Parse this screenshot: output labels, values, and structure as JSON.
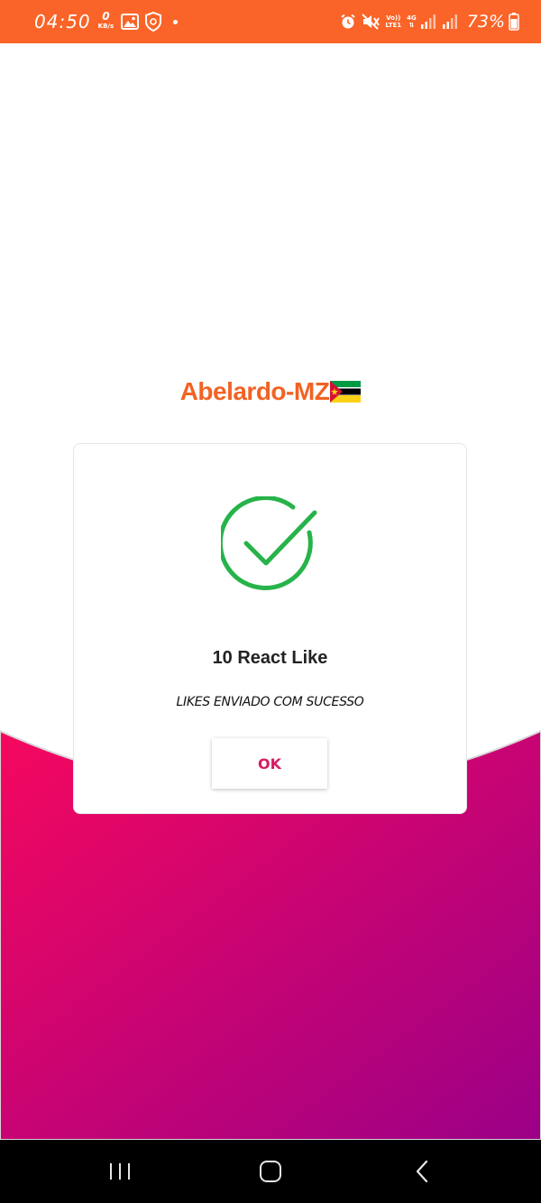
{
  "status_bar": {
    "time": "04:50",
    "speed_value": "0",
    "speed_unit": "KB/s",
    "volte_top": "Vo))",
    "volte_bottom": "LTE1",
    "network_type": "4G",
    "battery_percent": "73%",
    "background_color": "#fa6428"
  },
  "brand": {
    "name": "Abelardo-MZ",
    "color": "#f26224",
    "flag_icon": "mozambique-flag-icon"
  },
  "dialog": {
    "icon": "success-check-icon",
    "icon_color": "#27b34a",
    "title": "10 React Like",
    "message": "LIKES ENVIADO COM SUCESSO",
    "ok_label": "OK",
    "ok_color": "#d81b60"
  },
  "background": {
    "gradient_start": "#f5085e",
    "gradient_end": "#9b0087"
  },
  "nav_bar": {
    "recents_icon": "recents-icon",
    "home_icon": "home-icon",
    "back_icon": "back-icon"
  }
}
